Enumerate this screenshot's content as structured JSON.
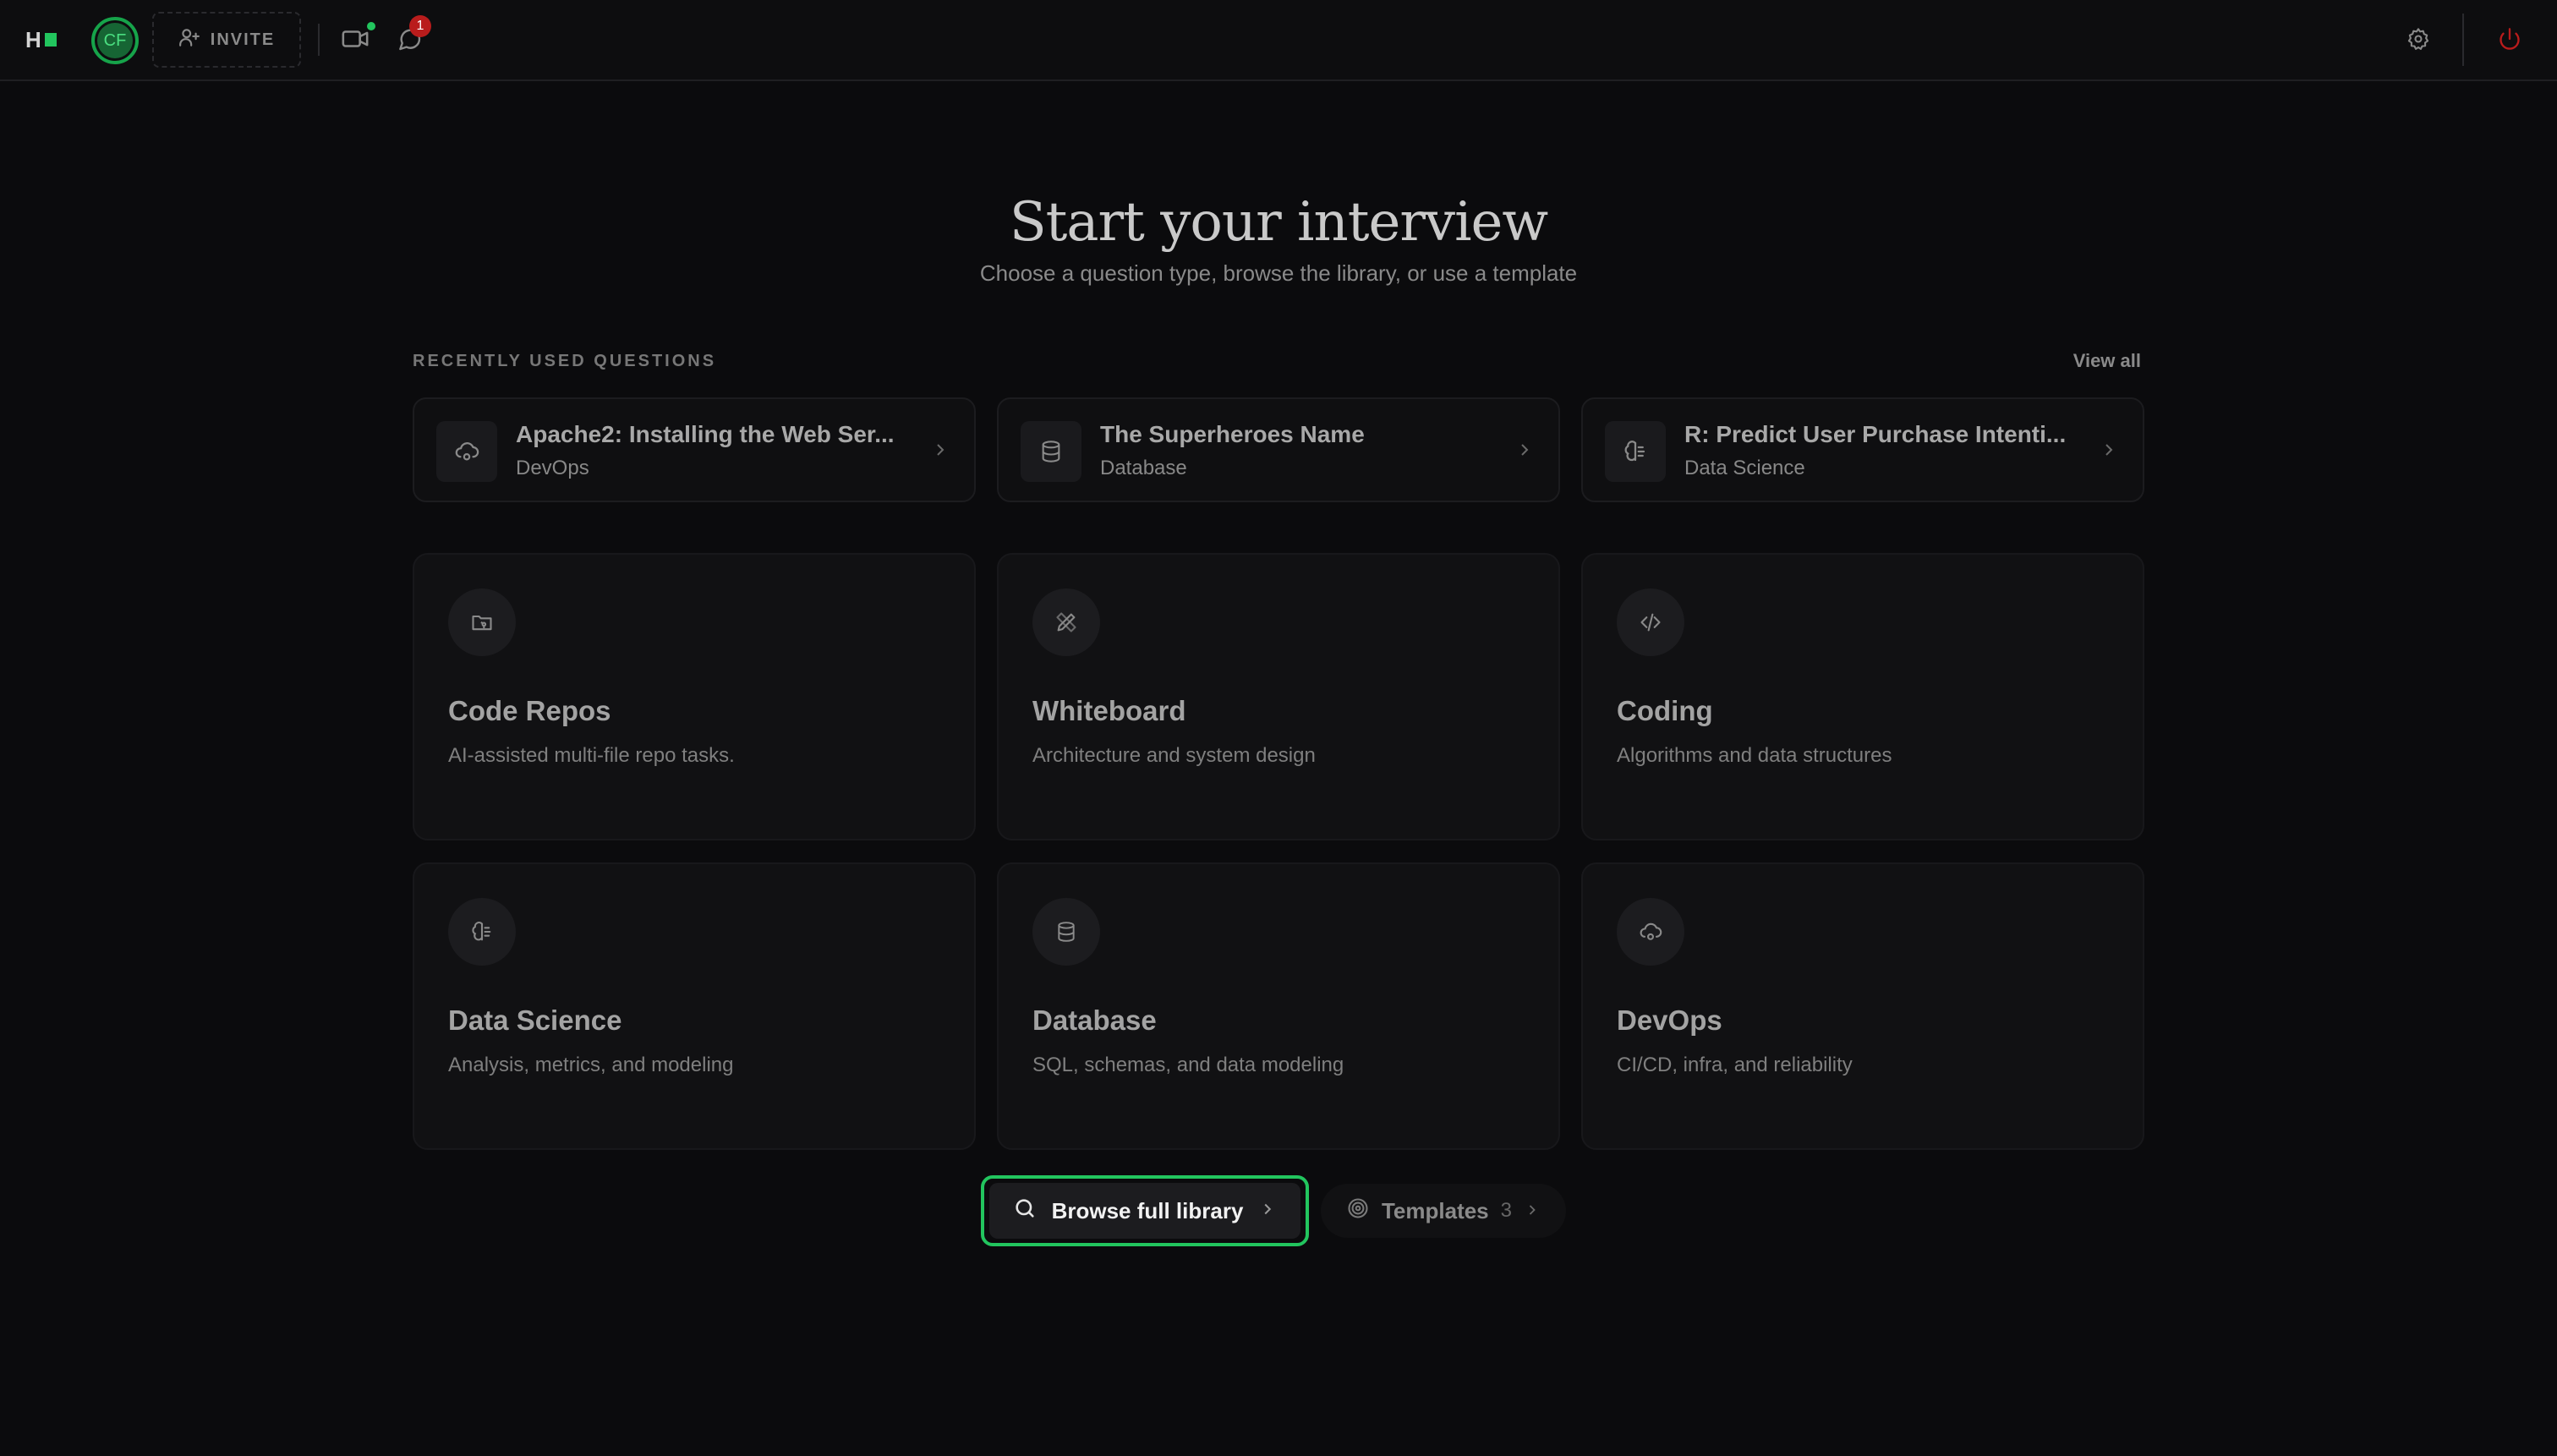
{
  "topbar": {
    "logo_text": "H",
    "avatar_initials": "CF",
    "invite_label": "INVITE",
    "notification_count": "1",
    "accent_color": "#22c55e",
    "danger_color": "#b91c1c"
  },
  "hero": {
    "title": "Start your interview",
    "subtitle": "Choose a question type, browse the library, or use a template"
  },
  "recent": {
    "label": "RECENTLY USED QUESTIONS",
    "view_all": "View all",
    "items": [
      {
        "title": "Apache2: Installing the Web Ser...",
        "category": "DevOps",
        "icon": "cloud-cog-icon"
      },
      {
        "title": "The Superheroes Name",
        "category": "Database",
        "icon": "database-icon"
      },
      {
        "title": "R: Predict User Purchase Intenti...",
        "category": "Data Science",
        "icon": "brain-icon"
      }
    ]
  },
  "types": [
    {
      "title": "Code Repos",
      "desc": "AI-assisted multi-file repo tasks.",
      "icon": "folder-git-icon"
    },
    {
      "title": "Whiteboard",
      "desc": "Architecture and system design",
      "icon": "pencil-ruler-icon"
    },
    {
      "title": "Coding",
      "desc": "Algorithms and data structures",
      "icon": "code-icon"
    },
    {
      "title": "Data Science",
      "desc": "Analysis, metrics, and modeling",
      "icon": "brain-icon"
    },
    {
      "title": "Database",
      "desc": "SQL, schemas, and data modeling",
      "icon": "database-icon"
    },
    {
      "title": "DevOps",
      "desc": "CI/CD, infra, and reliability",
      "icon": "cloud-cog-icon"
    }
  ],
  "actions": {
    "browse_label": "Browse full library",
    "templates_label": "Templates",
    "templates_count": "3"
  }
}
